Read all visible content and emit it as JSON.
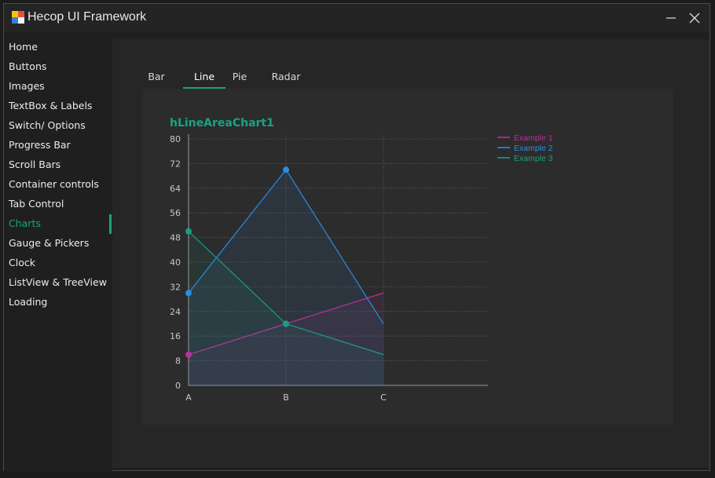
{
  "app": {
    "title": "Hecop UI Framework"
  },
  "titlebar": {
    "minimize": "minimize",
    "close": "close"
  },
  "sidebar": {
    "items": [
      {
        "label": "Home"
      },
      {
        "label": "Buttons"
      },
      {
        "label": "Images"
      },
      {
        "label": "TextBox & Labels"
      },
      {
        "label": "Switch/ Options"
      },
      {
        "label": "Progress Bar"
      },
      {
        "label": "Scroll Bars"
      },
      {
        "label": "Container controls"
      },
      {
        "label": "Tab Control"
      },
      {
        "label": "Charts",
        "active": true
      },
      {
        "label": "Gauge & Pickers"
      },
      {
        "label": "Clock"
      },
      {
        "label": "ListView & TreeView"
      },
      {
        "label": "Loading"
      }
    ]
  },
  "tabs": [
    {
      "label": "Bar"
    },
    {
      "label": "Line",
      "active": true
    },
    {
      "label": "Pie"
    },
    {
      "label": "Radar"
    }
  ],
  "colors": {
    "accent": "#19a381",
    "series1": "#c42a9a",
    "series2": "#2a8ce6",
    "series3": "#16a080"
  },
  "chart_data": {
    "type": "area",
    "title": "hLineAreaChart1",
    "categories": [
      "A",
      "B",
      "C"
    ],
    "ylim": [
      0,
      80
    ],
    "yticks": [
      "0",
      "8",
      "16",
      "24",
      "32",
      "40",
      "48",
      "56",
      "64",
      "72",
      "80"
    ],
    "grid": true,
    "legend": "top-right",
    "series": [
      {
        "name": "Example 1",
        "values": [
          10,
          20,
          30
        ],
        "color": "#c42a9a"
      },
      {
        "name": "Example 2",
        "values": [
          30,
          70,
          20
        ],
        "color": "#2a8ce6"
      },
      {
        "name": "Example 3",
        "values": [
          50,
          20,
          10
        ],
        "color": "#16a080"
      }
    ]
  }
}
